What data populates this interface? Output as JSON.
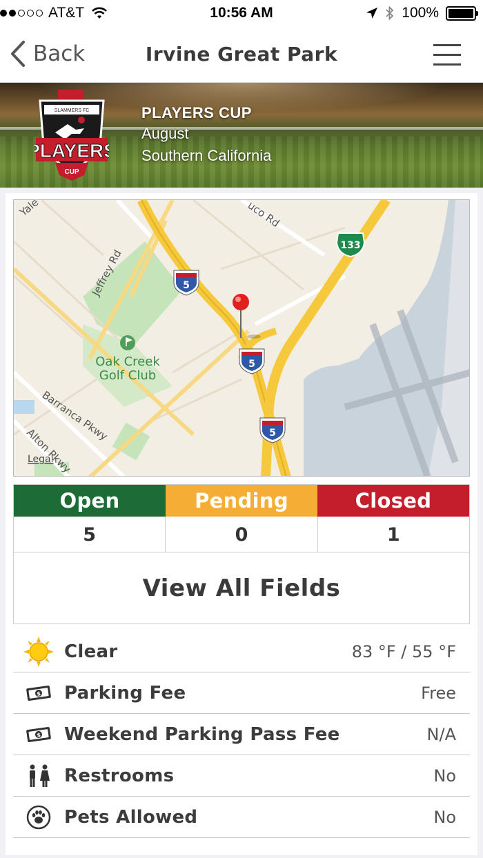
{
  "status_bar": {
    "carrier": "AT&T",
    "time": "10:56 AM",
    "battery": "100%",
    "signal_bars_filled": 2,
    "signal_bars_total": 5
  },
  "nav": {
    "back_label": "Back",
    "title": "Irvine Great Park"
  },
  "banner": {
    "logo_text": "PLAYERS",
    "logo_sub": "CUP",
    "logo_top": "SLAMMERS FC",
    "title": "PLAYERS CUP",
    "month": "August",
    "region": "Southern California"
  },
  "map": {
    "labels": {
      "road_yale": "Yale",
      "road_jeffrey": "Jeffrey Rd",
      "road_sand_canyon": "uco Rd",
      "road_barranca": "Barranca Pkwy",
      "road_alton": "Alton Pkwy",
      "poi_line1": "Oak Creek",
      "poi_line2": "Golf Club",
      "legal": "Legal",
      "i5": "5",
      "ca133": "133"
    }
  },
  "field_status": {
    "headers": {
      "open": "Open",
      "pending": "Pending",
      "closed": "Closed"
    },
    "counts": {
      "open": "5",
      "pending": "0",
      "closed": "1"
    },
    "colors": {
      "open": "#1d6b35",
      "pending": "#f5ad36",
      "closed": "#c41e2c"
    }
  },
  "view_all_label": "View All Fields",
  "info": {
    "weather": {
      "label": "Clear",
      "value": "83 °F / 55 °F",
      "icon": "sun-icon"
    },
    "parking": {
      "label": "Parking Fee",
      "value": "Free",
      "icon": "money-icon"
    },
    "weekend_parking": {
      "label": "Weekend Parking Pass Fee",
      "value": "N/A",
      "icon": "money-icon"
    },
    "restrooms": {
      "label": "Restrooms",
      "value": "No",
      "icon": "restroom-icon"
    },
    "pets": {
      "label": "Pets Allowed",
      "value": "No",
      "icon": "paw-icon"
    }
  }
}
